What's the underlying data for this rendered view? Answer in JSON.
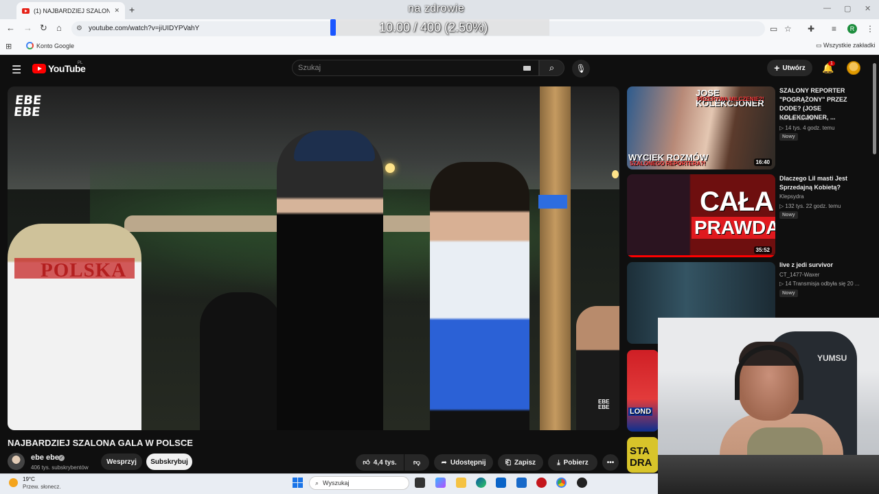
{
  "browser": {
    "tab_title": "(1) NAJBARDZIEJ SZALONA GA…",
    "new_tab": "+",
    "url": "youtube.com/watch?v=jiUIDYPVahY",
    "profile_letter": "R",
    "bookmarks": {
      "google_account": "Konto Google",
      "all_bookmarks": "Wszystkie zakładki"
    },
    "window_controls": [
      "—",
      "▢",
      "✕"
    ]
  },
  "stream_overlay": {
    "title": "na zdrowie",
    "counter": "10.00 / 400 (2.50%)",
    "progress_fraction": 0.025
  },
  "youtube": {
    "logo_text": "YouTube",
    "region": "PL",
    "search_placeholder": "Szukaj",
    "create_label": "Utwórz",
    "notifications_count": "1"
  },
  "video": {
    "watermark": "EBE EBE",
    "title": "NAJBARDZIEJ SZALONA GALA W POLSCE",
    "shirt_text": "POLSKA",
    "channel_name": "ebe ebe",
    "subscribers": "406 tys. subskrybentów",
    "support_label": "Wesprzyj",
    "subscribe_label": "Subskrybuj",
    "likes": "4,4 tys.",
    "share_label": "Udostępnij",
    "save_label": "Zapisz",
    "download_label": "Pobierz",
    "more_label": "•••"
  },
  "recommendations": [
    {
      "title": "SZALONY REPORTER \"POGRĄŻONY\" PRZEZ DODE? (JOSE KOLEKCJONER, ...",
      "channel": "INFLU NEWS",
      "stats": "▷ 14 tys.   4 godz. temu",
      "badge": "Nowy",
      "duration": "16:40",
      "thumb_texts": [
        "JOSE KOLEKCJONER",
        "PRZERYWA MILCZENIE?!",
        "WYCIEK ROZMÓW",
        "SZALONEGO REPORTERA?!"
      ]
    },
    {
      "title": "Dlaczego Lil masti Jest Sprzedajną Kobietą?",
      "channel": "Klepsydra",
      "stats": "▷ 132 tys.   22 godz. temu",
      "badge": "Nowy",
      "duration": "35:52",
      "thumb_texts": [
        "CAŁA",
        "PRAWDA"
      ]
    },
    {
      "title": "live z jedi survivor",
      "channel": "CT_1477-Waxer",
      "stats": "▷ 14   Transmisja odbyła się 20 ...",
      "badge": "Nowy"
    },
    {
      "thumb_texts": [
        "LOND"
      ]
    },
    {
      "thumb_texts": [
        "STA DRA"
      ]
    }
  ],
  "webcam": {
    "chair_brand": "YUMSU"
  },
  "taskbar": {
    "weather_temp": "19°C",
    "weather_desc": "Przew. słonecz.",
    "search_placeholder": "Wyszukaj"
  },
  "colors": {
    "yt_red": "#ff0000",
    "yt_bg": "#0f0f0f",
    "overlay_fill": "#1a56ff"
  }
}
